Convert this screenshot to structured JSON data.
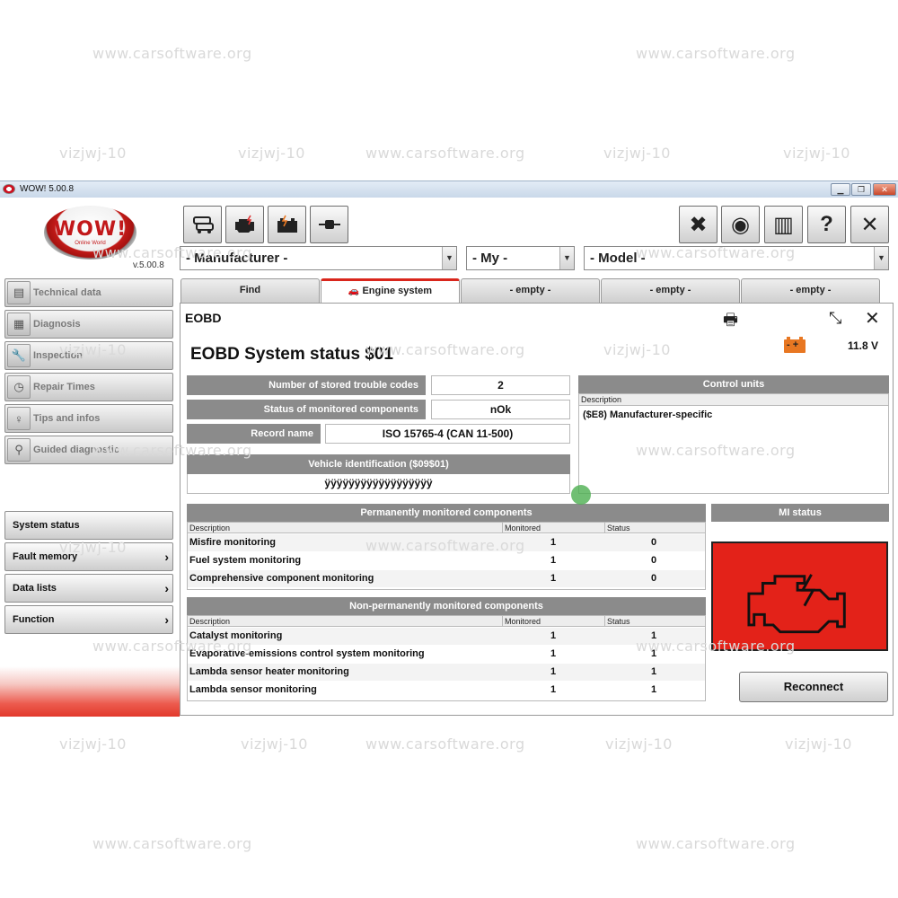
{
  "watermarks": {
    "site": "www.carsoftware.org",
    "id": "vizjwj-10"
  },
  "window": {
    "title": "WOW! 5.00.8",
    "controls": [
      "minimize-icon",
      "restore-icon",
      "close-icon"
    ]
  },
  "logo": {
    "text": "WOW!",
    "subtext": "Online World",
    "version": "v.5.00.8"
  },
  "toolbar": {
    "left_buttons": [
      "vehicle-list-icon",
      "engine-system-icon",
      "battery-icon",
      "connector-icon"
    ],
    "right_buttons": [
      {
        "icon": "tools-icon",
        "label": "✖"
      },
      {
        "icon": "connection-icon",
        "label": "◉"
      },
      {
        "icon": "gift-icon",
        "label": "▥"
      },
      {
        "icon": "help-icon",
        "label": "?"
      },
      {
        "icon": "close-icon",
        "label": "✕"
      }
    ]
  },
  "selectors": {
    "manufacturer": "- Manufacturer -",
    "my": "- My -",
    "model": "- Model -"
  },
  "sidebar": {
    "tools": [
      {
        "label": "Technical data",
        "icon": "technical-data-icon"
      },
      {
        "label": "Diagnosis",
        "icon": "diagnosis-icon"
      },
      {
        "label": "Inspection",
        "icon": "wrench-icon"
      },
      {
        "label": "Repair Times",
        "icon": "clock-icon"
      },
      {
        "label": "Tips and infos",
        "icon": "lightbulb-icon"
      },
      {
        "label": "Guided diagnostic",
        "icon": "magnifier-icon"
      }
    ],
    "menu": [
      {
        "label": "System status",
        "chevron": ""
      },
      {
        "label": "Fault memory",
        "chevron": "›"
      },
      {
        "label": "Data lists",
        "chevron": "›"
      },
      {
        "label": "Function",
        "chevron": "›"
      }
    ]
  },
  "tabs": [
    {
      "label": "Find"
    },
    {
      "label": "Engine system"
    },
    {
      "label": "- empty -"
    },
    {
      "label": "- empty -"
    },
    {
      "label": "- empty -"
    }
  ],
  "panel": {
    "title": "EOBD",
    "system_title": "EOBD System status  $01",
    "voltage": "11.8 V",
    "stored_codes_label": "Number of stored trouble codes",
    "stored_codes_value": "2",
    "monitor_status_label": "Status of monitored components",
    "monitor_status_value": "nOk",
    "record_label": "Record name",
    "record_value": "ISO 15765-4 (CAN 11-500)",
    "vin_label": "Vehicle identification   ($09$01)",
    "vin_value": "ÿÿÿÿÿÿÿÿÿÿÿÿÿÿÿÿÿÿ",
    "control_units": {
      "header": "Control units",
      "col": "Description",
      "rows": [
        "($E8) Manufacturer-specific"
      ]
    },
    "permanent": {
      "header": "Permanently monitored components",
      "cols": [
        "Description",
        "Monitored",
        "Status"
      ],
      "rows": [
        {
          "desc": "Misfire monitoring",
          "mon": "1",
          "status": "0"
        },
        {
          "desc": "Fuel system monitoring",
          "mon": "1",
          "status": "0"
        },
        {
          "desc": "Comprehensive component monitoring",
          "mon": "1",
          "status": "0"
        }
      ]
    },
    "non_permanent": {
      "header": "Non-permanently monitored components",
      "cols": [
        "Description",
        "Monitored",
        "Status"
      ],
      "rows": [
        {
          "desc": "Catalyst monitoring",
          "mon": "1",
          "status": "1"
        },
        {
          "desc": "Evaporative-emissions control system monitoring",
          "mon": "1",
          "status": "1"
        },
        {
          "desc": "Lambda sensor heater monitoring",
          "mon": "1",
          "status": "1"
        },
        {
          "desc": "Lambda sensor monitoring",
          "mon": "1",
          "status": "1"
        }
      ]
    },
    "mi_status": {
      "header": "MI status",
      "state_color": "#e32219",
      "icon": "check-engine-icon"
    },
    "reconnect_label": "Reconnect"
  },
  "colors": {
    "accent_red": "#d9261c",
    "header_gray": "#8b8b8b",
    "battery_orange": "#e87722"
  }
}
